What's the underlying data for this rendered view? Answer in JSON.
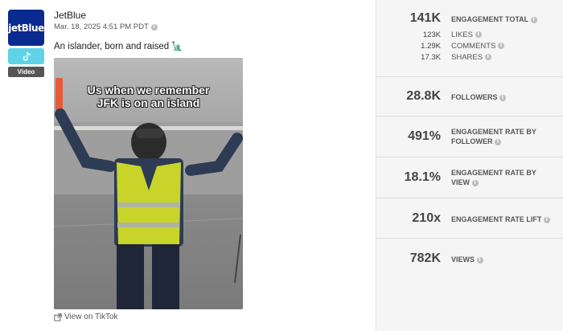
{
  "post": {
    "avatar_text": "jetBlue",
    "platform_icon": "tiktok-icon",
    "media_type": "Video",
    "account_name": "JetBlue",
    "timestamp": "Mar. 18, 2025 4:51 PM PDT",
    "caption": "An islander, born and raised 🗽",
    "video_overlay_line1": "Us when we remember",
    "video_overlay_line2": "JFK is on an island",
    "view_link": "View on TikTok"
  },
  "metrics": {
    "engagement_total": {
      "value": "141K",
      "label": "ENGAGEMENT TOTAL"
    },
    "likes": {
      "value": "123K",
      "label": "LIKES"
    },
    "comments": {
      "value": "1.29K",
      "label": "COMMENTS"
    },
    "shares": {
      "value": "17.3K",
      "label": "SHARES"
    },
    "followers": {
      "value": "28.8K",
      "label": "FOLLOWERS"
    },
    "er_follower": {
      "value": "491%",
      "label_line1": "ENGAGEMENT RATE BY",
      "label_line2": "FOLLOWER"
    },
    "er_view": {
      "value": "18.1%",
      "label_line1": "ENGAGEMENT RATE BY",
      "label_line2": "VIEW"
    },
    "er_lift": {
      "value": "210x",
      "label": "ENGAGEMENT RATE LIFT"
    },
    "views": {
      "value": "782K",
      "label": "VIEWS"
    }
  },
  "colors": {
    "brand_blue": "#0b2a8f",
    "tiktok_badge": "#5ed3e8",
    "vest": "#c8d42a"
  }
}
